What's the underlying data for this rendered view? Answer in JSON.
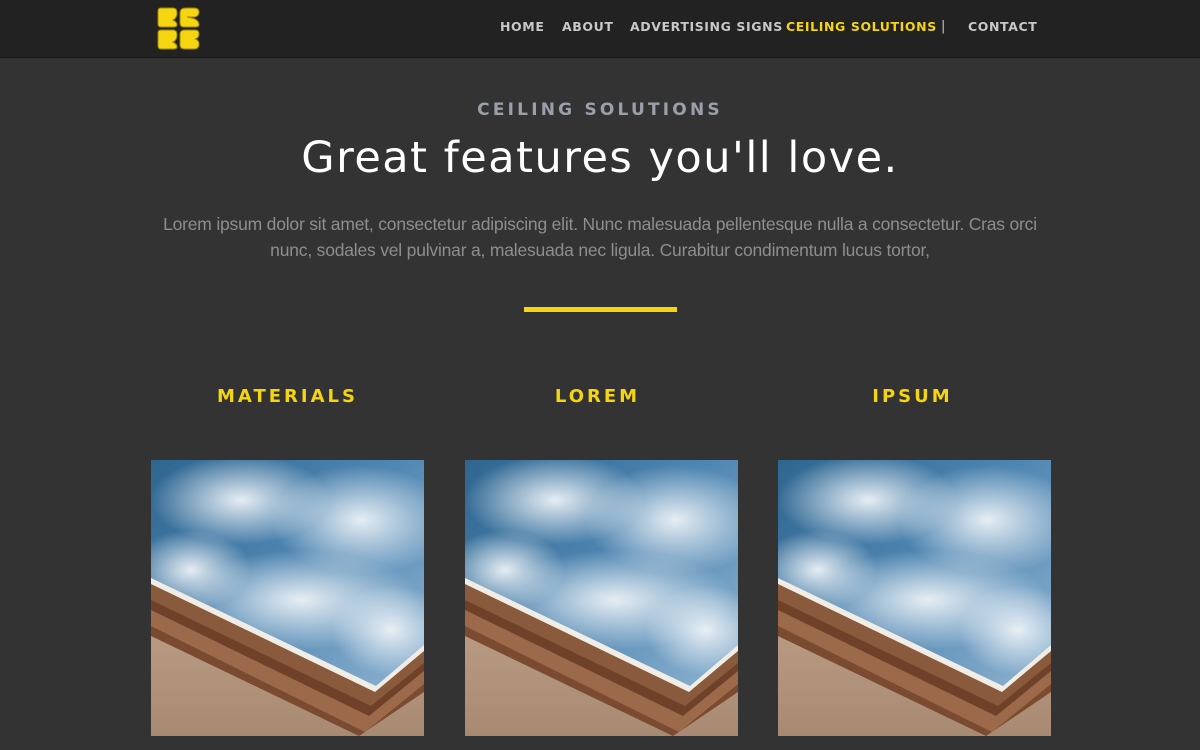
{
  "header": {
    "logo_icon": "bs-logo-icon",
    "nav": [
      {
        "label": "HOME"
      },
      {
        "label": "ABOUT"
      },
      {
        "label": "ADVERTISING SIGNS"
      },
      {
        "label": "CEILING SOLUTIONS",
        "active": true
      },
      {
        "label": "CONTACT"
      }
    ],
    "separator": "|"
  },
  "hero": {
    "eyebrow": "CEILING SOLUTIONS",
    "headline": "Great features you'll love.",
    "intro": "Lorem ipsum dolor sit amet, consectetur adipiscing elit. Nunc malesuada pellentesque nulla a consectetur. Cras orci nunc, sodales vel pulvinar a, malesuada nec ligula. Curabitur condimentum lucus tortor,"
  },
  "features": [
    {
      "title": "MATERIALS",
      "image": "sky-ceiling-photo"
    },
    {
      "title": "LOREM",
      "image": "sky-ceiling-photo"
    },
    {
      "title": "IPSUM",
      "image": "sky-ceiling-photo"
    }
  ],
  "colors": {
    "accent": "#f5d410",
    "background": "#333333",
    "header_background": "#222222",
    "headline": "#ffffff",
    "body_text": "#8e8e8e"
  }
}
